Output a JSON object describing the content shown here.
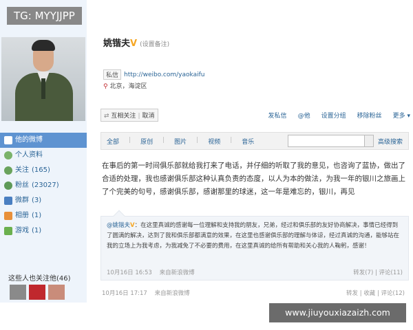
{
  "overlay_tag": "TG: MYYJJPP",
  "watermark": "www.jiuyouxiazaizh.com",
  "profile": {
    "name": "姚锴夫",
    "v_badge": "V",
    "remark": "(设置备注)",
    "msg_label": "私信",
    "url": "http://weibo.com/yaokaifu",
    "location": "北京，海淀区"
  },
  "actions": {
    "mutual_label": "互相关注",
    "cancel_label": "取消",
    "buttons": [
      "发私信",
      "@他",
      "设置分组",
      "移除粉丝",
      "更多 ▾"
    ]
  },
  "sidebar": {
    "items": [
      {
        "label": "他的微博",
        "count": ""
      },
      {
        "label": "个人资料",
        "count": ""
      },
      {
        "label": "关注",
        "count": "(165)"
      },
      {
        "label": "粉丝",
        "count": "(23027)"
      },
      {
        "label": "微群",
        "count": "(3)"
      },
      {
        "label": "相册",
        "count": "(1)"
      },
      {
        "label": "游戏",
        "count": "(1)"
      }
    ],
    "follow_title": "这些人也关注他(46)"
  },
  "filter": {
    "tabs": [
      "全部",
      "原创",
      "图片",
      "视频",
      "音乐"
    ],
    "advanced_search": "高级搜索"
  },
  "post": {
    "text": "在事后的第一时间俱乐部就给我打来了电话，并仔细的听取了我的意见，也咨询了蓝协，做出了合适的处理，我也感谢俱乐部这种认真负责的态度，以人为本的做法，为我一年的银川之旅画上了个完美的句号，感谢俱乐部，感谢那里的球迷，这一年是难忘的，银川，再见",
    "time": "10月16日 17:17",
    "source": "来自新浪微博",
    "stats": "转发 | 收藏 | 评论(12)"
  },
  "repost": {
    "author": "@姚锴夫",
    "v_badge": "V",
    "text": "：在这里真诚的感谢每一位理解和支持我的朋友，兄弟，经过和俱乐部的友好协商解决，事情已经得到了圆满的解决，达到了我和俱乐部都满意的效果，在这里也感谢俱乐部的理解与体谅，经过真诚的沟通，能够站在我的立场上为我考虑，为我减免了不必要的费用，在这里真诚的给所有帮助和关心我的人鞠躬，感谢！",
    "time": "10月16日 16:53",
    "source": "来自新浪微博",
    "stats": "转发(7) | 评论(11)"
  }
}
